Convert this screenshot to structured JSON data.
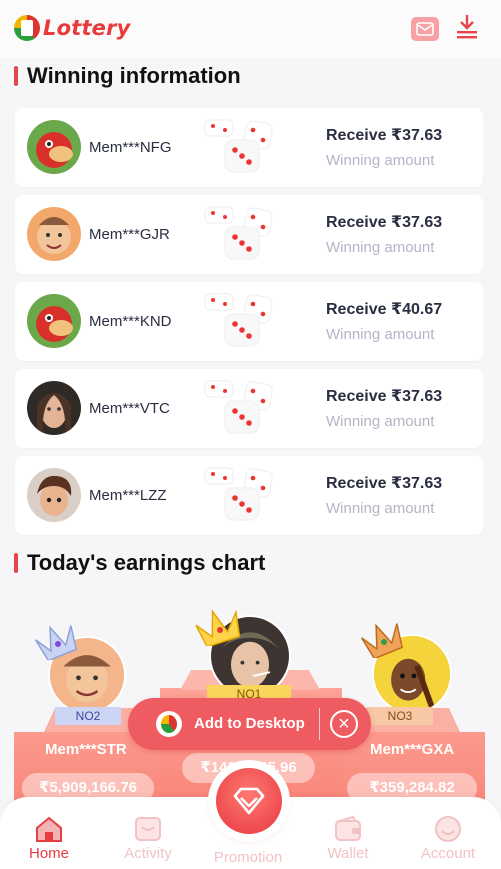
{
  "header": {
    "brand": "Lottery",
    "mail_icon": "mail-icon",
    "download_icon": "download-icon",
    "accent": "#e93b3b"
  },
  "winning": {
    "title": "Winning information",
    "items": [
      {
        "user": "Mem***NFG",
        "receive": "Receive ₹37.63",
        "label": "Winning amount",
        "avatar": "red-parrot"
      },
      {
        "user": "Mem***GJR",
        "receive": "Receive ₹37.63",
        "label": "Winning amount",
        "avatar": "old-man"
      },
      {
        "user": "Mem***KND",
        "receive": "Receive ₹40.67",
        "label": "Winning amount",
        "avatar": "red-parrot"
      },
      {
        "user": "Mem***VTC",
        "receive": "Receive ₹37.63",
        "label": "Winning amount",
        "avatar": "woman"
      },
      {
        "user": "Mem***LZZ",
        "receive": "Receive ₹37.63",
        "label": "Winning amount",
        "avatar": "boy"
      }
    ]
  },
  "earnings": {
    "title": "Today's earnings chart",
    "podium": [
      {
        "rank": "NO2",
        "user": "Mem***STR",
        "amount": "₹5,909,166.76"
      },
      {
        "rank": "NO1",
        "user": "",
        "amount": "₹142…745.96"
      },
      {
        "rank": "NO3",
        "user": "Mem***GXA",
        "amount": "₹359,284.82"
      }
    ]
  },
  "add_to_desktop": {
    "label": "Add to Desktop",
    "close_icon": "close-circle-icon"
  },
  "nav": {
    "items": [
      {
        "label": "Home",
        "icon": "home-icon",
        "active": true
      },
      {
        "label": "Activity",
        "icon": "gift-icon",
        "active": false
      },
      {
        "label": "Promotion",
        "icon": "diamond-icon",
        "active": false
      },
      {
        "label": "Wallet",
        "icon": "wallet-icon",
        "active": false
      },
      {
        "label": "Account",
        "icon": "face-icon",
        "active": false
      }
    ]
  }
}
